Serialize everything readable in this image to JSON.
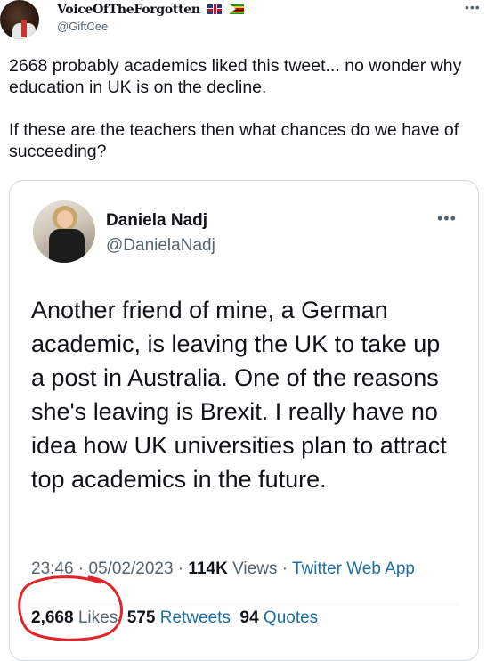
{
  "author": {
    "display_name": "VoiceOfTheForgotten",
    "flags": [
      "uk-flag",
      "zimbabwe-flag"
    ],
    "handle": "@GiftCee",
    "more_icon": "more-horizontal-icon"
  },
  "tweet": {
    "paragraphs": [
      "2668 probably academics liked this tweet... no wonder why education in UK is on the decline.",
      "If these are the teachers then what chances do we have of succeeding?"
    ]
  },
  "quoted_tweet": {
    "display_name": "Daniela Nadj",
    "handle": "@DanielaNadj",
    "text": "Another friend of mine, a German academic, is leaving the UK to take up a post in Australia. One of the reasons she's leaving is Brexit.  I really have no idea how UK universities plan to attract top academics in the future.",
    "time": "23:46",
    "date": "05/02/2023",
    "views_count": "114K",
    "views_label": "Views",
    "source": "Twitter Web App",
    "likes_count": "2,668",
    "likes_label": "Likes",
    "retweets_count": "575",
    "retweets_label": "Retweets",
    "quotes_count": "94",
    "quotes_label": "Quotes",
    "separator": "·"
  },
  "annotation": {
    "scribble_color": "#e0242a"
  }
}
